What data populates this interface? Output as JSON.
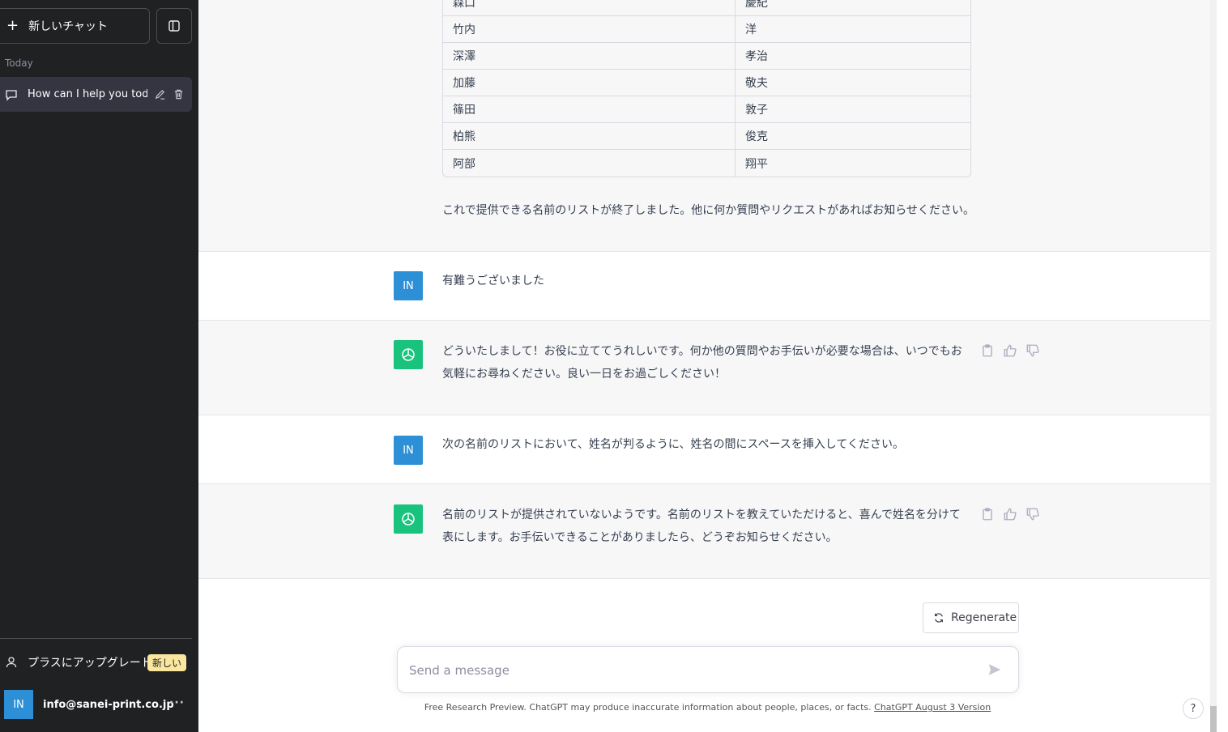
{
  "sidebar": {
    "new_chat_label": "新しいチャット",
    "section_today": "Today",
    "chat_title": "How can I help you toda",
    "upgrade_label": "プラスにアップグレード",
    "upgrade_badge": "新しい",
    "account_initials": "IN",
    "account_email": "info@sanei-print.co.jp",
    "more_label": "···"
  },
  "table_rows": [
    {
      "last": "森口",
      "first": "慶紀"
    },
    {
      "last": "竹内",
      "first": "洋"
    },
    {
      "last": "深澤",
      "first": "孝治"
    },
    {
      "last": "加藤",
      "first": "敬夫"
    },
    {
      "last": "篠田",
      "first": "敦子"
    },
    {
      "last": "柏熊",
      "first": "俊克"
    },
    {
      "last": "阿部",
      "first": "翔平"
    }
  ],
  "messages": {
    "a1_text": "これで提供できる名前のリストが終了しました。他に何か質問やリクエストがあればお知らせください。",
    "u1_initials": "IN",
    "u1_text": "有難うございました",
    "a2_text": "どういたしまして！お役に立ててうれしいです。何か他の質問やお手伝いが必要な場合は、いつでもお気軽にお尋ねください。良い一日をお過ごしください！",
    "u2_initials": "IN",
    "u2_text": "次の名前のリストにおいて、姓名が判るように、姓名の間にスペースを挿入してください。",
    "a3_text": "名前のリストが提供されていないようです。名前のリストを教えていただけると、喜んで姓名を分けて表にします。お手伝いできることがありましたら、どうぞお知らせください。"
  },
  "composer": {
    "regenerate_label": "Regenerate",
    "placeholder": "Send a message"
  },
  "footer": {
    "text": "Free Research Preview. ChatGPT may produce inaccurate information about people, places, or facts. ",
    "link": "ChatGPT August 3 Version"
  },
  "help_label": "?",
  "colors": {
    "sidebar_bg": "#202123",
    "assistant_bg": "#f7f7f8",
    "user_avatar": "#2d8fd5",
    "gpt_avatar": "#19c37d",
    "badge_bg": "#fae69e"
  }
}
